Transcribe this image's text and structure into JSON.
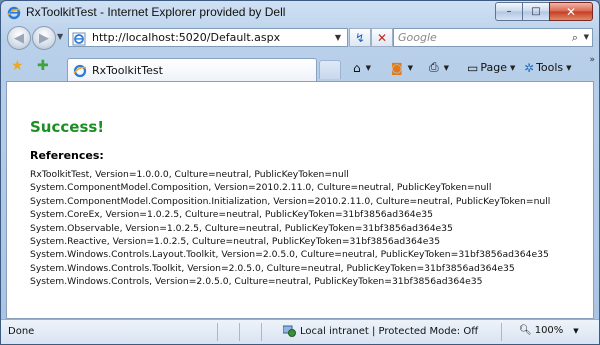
{
  "window": {
    "title": "RxToolkitTest - Internet Explorer provided by Dell",
    "caption_buttons": {
      "minimize": "–",
      "maximize": "□",
      "close": "✕"
    }
  },
  "navbar": {
    "address": "http://localhost:5020/Default.aspx",
    "search_placeholder": "Google",
    "refresh_glyph": "↯",
    "stop_glyph": "✕",
    "search_glyph": "⌕"
  },
  "tabbar": {
    "tab_label": "RxToolkitTest",
    "commands": {
      "page_label": "Page",
      "tools_label": "Tools"
    }
  },
  "content": {
    "heading": "Success!",
    "subheading": "References:",
    "references": [
      "RxToolkitTest, Version=1.0.0.0, Culture=neutral, PublicKeyToken=null",
      "System.ComponentModel.Composition, Version=2010.2.11.0, Culture=neutral, PublicKeyToken=null",
      "System.ComponentModel.Composition.Initialization, Version=2010.2.11.0, Culture=neutral, PublicKeyToken=null",
      "System.CoreEx, Version=1.0.2.5, Culture=neutral, PublicKeyToken=31bf3856ad364e35",
      "System.Observable, Version=1.0.2.5, Culture=neutral, PublicKeyToken=31bf3856ad364e35",
      "System.Reactive, Version=1.0.2.5, Culture=neutral, PublicKeyToken=31bf3856ad364e35",
      "System.Windows.Controls.Layout.Toolkit, Version=2.0.5.0, Culture=neutral, PublicKeyToken=31bf3856ad364e35",
      "System.Windows.Controls.Toolkit, Version=2.0.5.0, Culture=neutral, PublicKeyToken=31bf3856ad364e35",
      "System.Windows.Controls, Version=2.0.5.0, Culture=neutral, PublicKeyToken=31bf3856ad364e35"
    ]
  },
  "statusbar": {
    "status": "Done",
    "zone": "Local intranet | Protected Mode: Off",
    "zoom": "100%"
  },
  "colors": {
    "success": "#1c8f24",
    "ie_blue": "#1e62c9",
    "ie_gold": "#f0a818"
  },
  "icons": [
    "ie-logo-icon",
    "back-arrow-icon",
    "forward-arrow-icon",
    "refresh-icon",
    "stop-icon",
    "search-icon",
    "favorites-star-icon",
    "add-favorites-icon",
    "home-icon",
    "feeds-icon",
    "print-icon",
    "page-icon",
    "tools-gear-icon",
    "intranet-globe-icon",
    "zoom-icon"
  ]
}
